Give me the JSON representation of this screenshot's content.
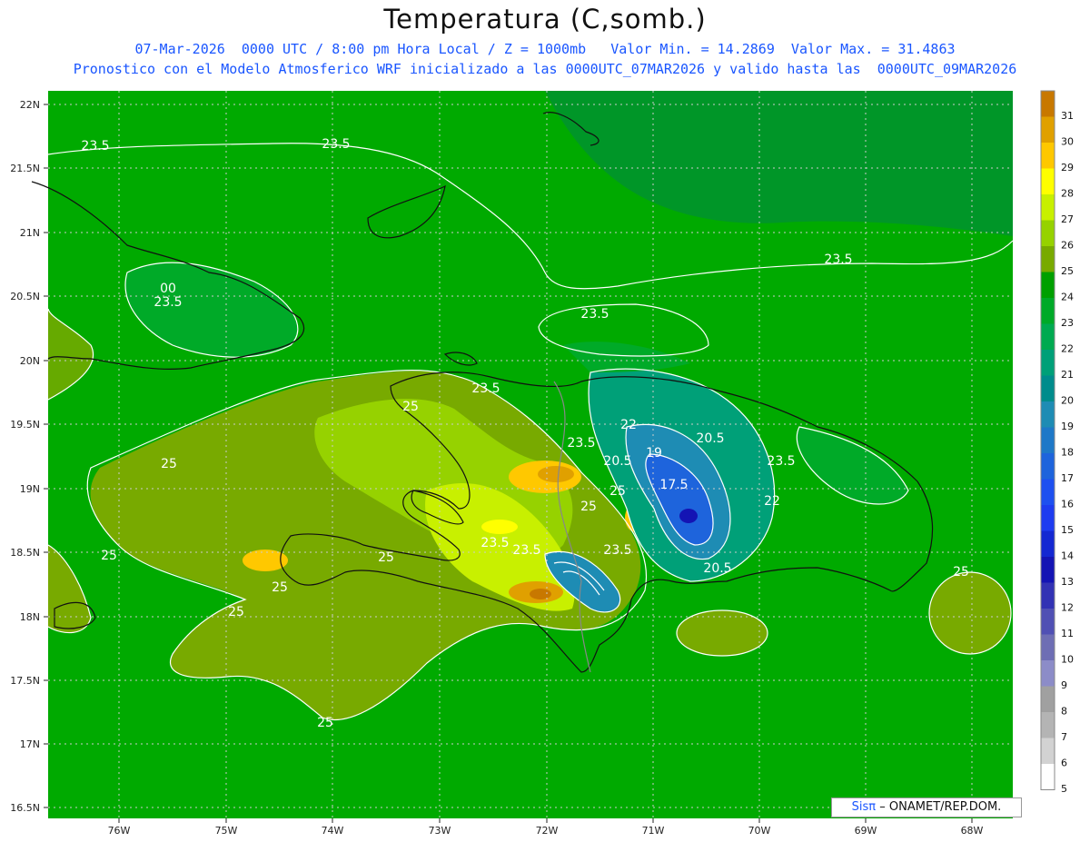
{
  "header": {
    "title": "Temperatura (C,somb.)",
    "line1": "07-Mar-2026  0000 UTC / 8:00 pm Hora Local / Z = 1000mb   Valor Min. = 14.2869  Valor Max. = 31.4863",
    "line2": "Pronostico con el Modelo Atmosferico WRF inicializado a las 0000UTC_07MAR2026 y valido hasta las  0000UTC_09MAR2026"
  },
  "axes": {
    "lat_labels": [
      "22N",
      "21.5N",
      "21N",
      "20.5N",
      "20N",
      "19.5N",
      "19N",
      "18.5N",
      "18N",
      "17.5N",
      "17N",
      "16.5N"
    ],
    "lon_labels": [
      "76W",
      "75W",
      "74W",
      "73W",
      "72W",
      "71W",
      "70W",
      "69W",
      "68W"
    ]
  },
  "colorbar": {
    "labels": [
      "31",
      "30",
      "29",
      "28",
      "27",
      "26",
      "25",
      "24",
      "23",
      "22",
      "21",
      "20",
      "19",
      "18",
      "17",
      "16",
      "15",
      "14",
      "13",
      "12",
      "11",
      "10",
      "9",
      "8",
      "7",
      "6",
      "5"
    ],
    "colors": [
      "#c87800",
      "#e0a000",
      "#ffc800",
      "#ffff00",
      "#c8f000",
      "#96d200",
      "#78aa00",
      "#00a000",
      "#00aa28",
      "#00aa50",
      "#00a078",
      "#008c8c",
      "#1e8cb4",
      "#1e78c8",
      "#1e64dc",
      "#1e50f0",
      "#1e3cf0",
      "#1428d2",
      "#1414b4",
      "#3232b4",
      "#5050b4",
      "#6e6eb4",
      "#8c8cc8",
      "#a0a0a0",
      "#b4b4b4",
      "#d2d2d2",
      "#ffffff"
    ]
  },
  "contour_labels": [
    {
      "text": "23.5"
    },
    {
      "text": "23.5"
    },
    {
      "text": "23.5"
    },
    {
      "text": "23.5"
    },
    {
      "text": "23.5"
    },
    {
      "text": "23.5"
    },
    {
      "text": "23.5"
    },
    {
      "text": "23.5"
    },
    {
      "text": "23.5"
    },
    {
      "text": "23.5"
    },
    {
      "text": "23.5"
    },
    {
      "text": "25"
    },
    {
      "text": "25"
    },
    {
      "text": "25"
    },
    {
      "text": "25"
    },
    {
      "text": "25"
    },
    {
      "text": "25"
    },
    {
      "text": "25"
    },
    {
      "text": "25"
    },
    {
      "text": "25"
    },
    {
      "text": "25"
    },
    {
      "text": "22"
    },
    {
      "text": "22"
    },
    {
      "text": "20.5"
    },
    {
      "text": "20.5"
    },
    {
      "text": "20.5"
    },
    {
      "text": "19"
    },
    {
      "text": "17.5"
    },
    {
      "text": "00"
    }
  ],
  "credit": {
    "sis": "Sisπ",
    "rest": "– ONAMET/REP.DOM."
  },
  "colors": {
    "sea": "#00aa00",
    "header_blue": "#1a56ff"
  }
}
